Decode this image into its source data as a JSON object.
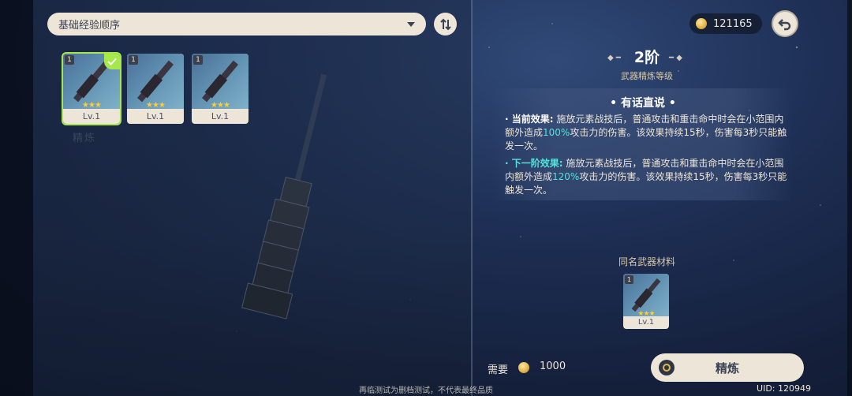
{
  "sort": {
    "selected": "基础经验顺序"
  },
  "weapons": [
    {
      "refine": "1",
      "stars": "★★★",
      "level": "Lv.1",
      "selected": true
    },
    {
      "refine": "1",
      "stars": "★★★",
      "level": "Lv.1",
      "selected": false
    },
    {
      "refine": "1",
      "stars": "★★★",
      "level": "Lv.1",
      "selected": false
    }
  ],
  "background_hint": "精炼",
  "currency": {
    "mora": "121165"
  },
  "refinement": {
    "rank": "2阶",
    "rank_subtitle": "武器精炼等级",
    "effect_name": "有话直说",
    "current_label": "当前效果:",
    "current_text_a": "施放元素战技后，普通攻击和重击命中时会在小范围内额外造成",
    "current_value": "100%",
    "current_text_b": "攻击力的伤害。该效果持续15秒，伤害每3秒只能触发一次。",
    "next_label": "下一阶效果:",
    "next_text_a": "施放元素战技后，普通攻击和重击命中时会在小范围内额外造成",
    "next_value": "120%",
    "next_text_b": "攻击力的伤害。该效果持续15秒，伤害每3秒只能触发一次。"
  },
  "material": {
    "title": "同名武器材料",
    "refine": "1",
    "stars": "★★★",
    "level": "Lv.1"
  },
  "cost": {
    "label": "需要",
    "value": "1000"
  },
  "action": {
    "label": "精炼"
  },
  "footer": {
    "disclaimer": "再临测试为删档测试，不代表最终品质",
    "uid": "UID: 120949"
  },
  "colors": {
    "highlight": "#53e3dc",
    "selected_outline": "#a6e84a",
    "panel_cream": "#ece5d8",
    "star": "#ffcc33"
  }
}
